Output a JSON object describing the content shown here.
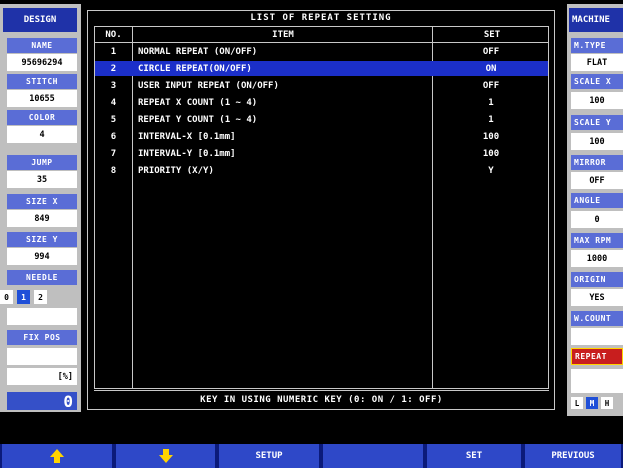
{
  "left_panel": {
    "header": "DESIGN",
    "fields": [
      {
        "label": "NAME",
        "value": "95696294"
      },
      {
        "label": "STITCH",
        "value": "10655"
      },
      {
        "label": "COLOR",
        "value": "4"
      },
      {
        "label": "JUMP",
        "value": "35"
      },
      {
        "label": "SIZE X",
        "value": "849"
      },
      {
        "label": "SIZE Y",
        "value": "994"
      }
    ],
    "needle_label": "NEEDLE",
    "needle_options": [
      "0",
      "1",
      "2"
    ],
    "needle_selected": "1",
    "fix_pos_label": "FIX POS",
    "percent_label": "[%]",
    "counter": "0"
  },
  "right_panel": {
    "header": "MACHINE",
    "fields": [
      {
        "label": "M.TYPE",
        "value": "FLAT"
      },
      {
        "label": "SCALE X",
        "value": "100"
      },
      {
        "label": "SCALE Y",
        "value": "100"
      },
      {
        "label": "MIRROR",
        "value": "OFF"
      },
      {
        "label": "ANGLE",
        "value": "0"
      },
      {
        "label": "MAX RPM",
        "value": "1000"
      },
      {
        "label": "ORIGIN",
        "value": "YES"
      },
      {
        "label": "W.COUNT",
        "value": ""
      }
    ],
    "mode_badge": "REPEAT",
    "size_options": [
      "L",
      "M",
      "H"
    ],
    "size_selected": "M"
  },
  "main": {
    "title": "LIST OF REPEAT SETTING",
    "columns": [
      "NO.",
      "ITEM",
      "SET"
    ],
    "rows": [
      {
        "no": "1",
        "item": "NORMAL REPEAT (ON/OFF)",
        "set": "OFF"
      },
      {
        "no": "2",
        "item": "CIRCLE REPEAT(ON/OFF)",
        "set": "ON"
      },
      {
        "no": "3",
        "item": "USER INPUT REPEAT (ON/OFF)",
        "set": "OFF"
      },
      {
        "no": "4",
        "item": "REPEAT X COUNT (1 ~ 4)",
        "set": "1"
      },
      {
        "no": "5",
        "item": "REPEAT Y COUNT (1 ~ 4)",
        "set": "1"
      },
      {
        "no": "6",
        "item": "INTERVAL-X [0.1mm]",
        "set": "100"
      },
      {
        "no": "7",
        "item": "INTERVAL-Y [0.1mm]",
        "set": "100"
      },
      {
        "no": "8",
        "item": "PRIORITY (X/Y)",
        "set": "Y"
      }
    ],
    "selected_row": 1,
    "footer": "KEY IN USING NUMERIC KEY (0: ON / 1: OFF)"
  },
  "buttons": {
    "up": "up-arrow-icon",
    "down": "down-arrow-icon",
    "setup": "SETUP",
    "blank": "",
    "set": "SET",
    "previous": "PREVIOUS"
  },
  "colors": {
    "selection": "#1b2fc9",
    "button_bg": "#2e48c8",
    "arrow": "#ffd400",
    "mode_badge": "#c81e1e"
  }
}
